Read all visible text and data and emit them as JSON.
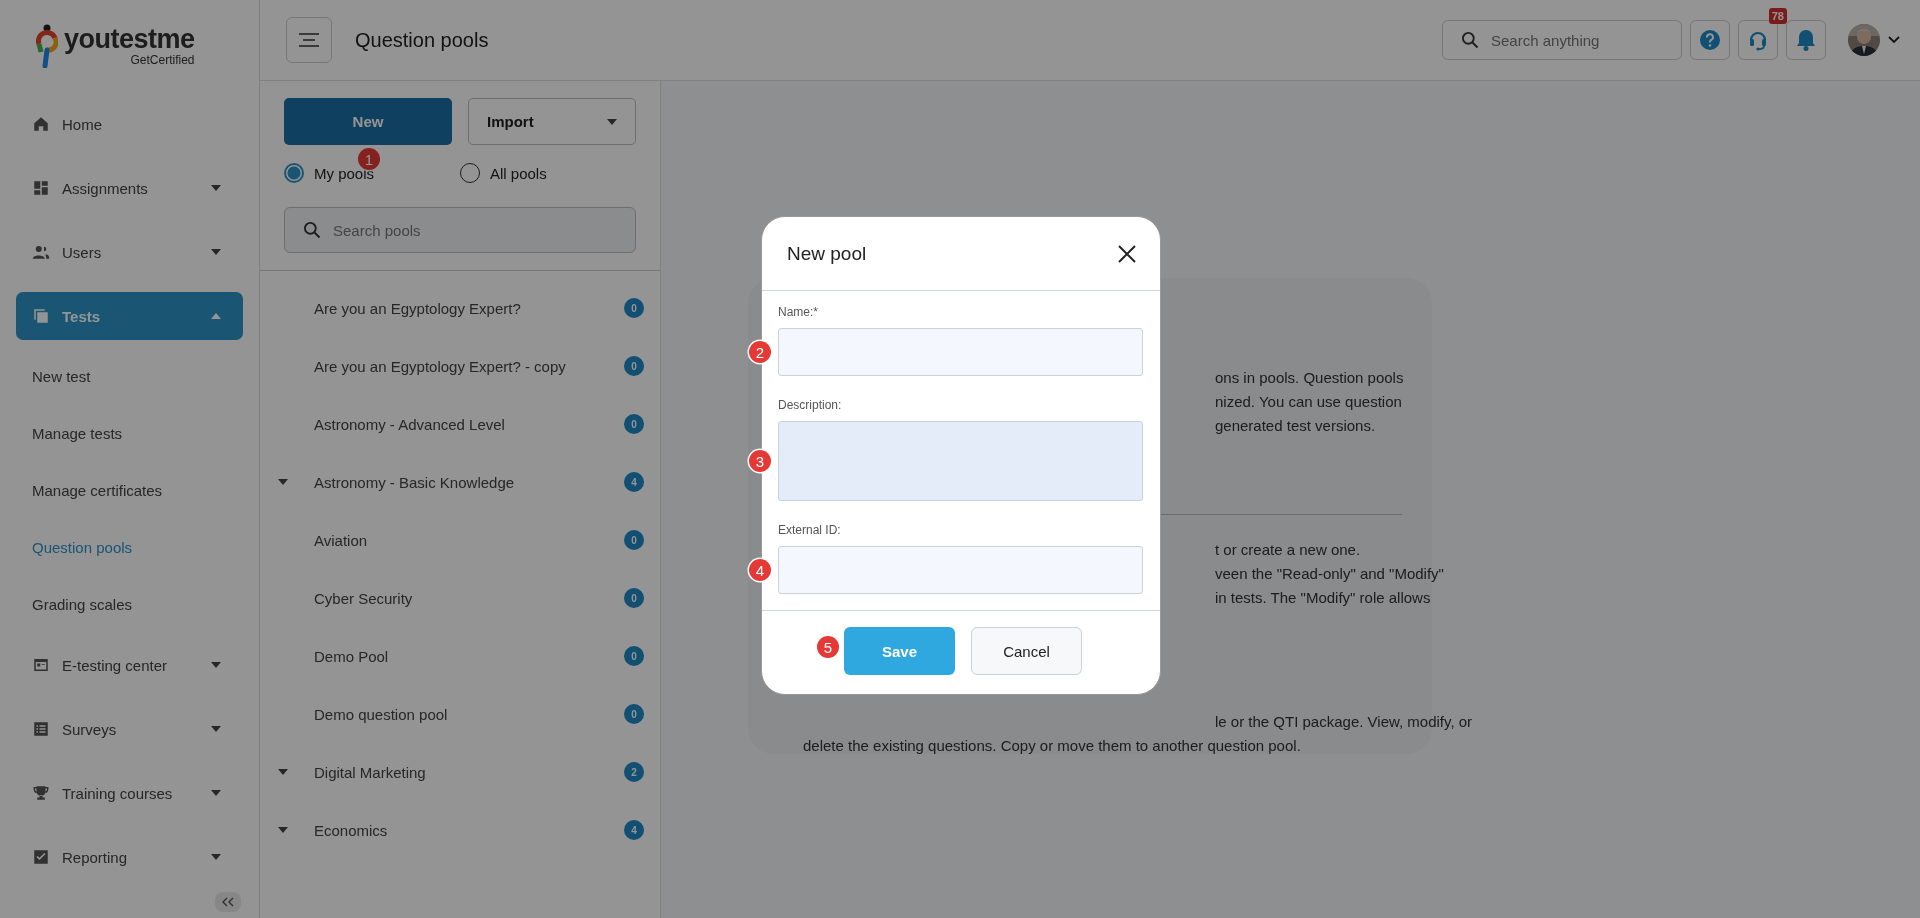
{
  "logo": {
    "brand": "youtestme",
    "tagline": "GetCertified"
  },
  "sidebar": {
    "items": [
      {
        "label": "Home",
        "selected": false,
        "kind": "main"
      },
      {
        "label": "Assignments",
        "expanded": false,
        "selected": false,
        "kind": "main"
      },
      {
        "label": "Users",
        "expanded": false,
        "selected": false,
        "kind": "main"
      },
      {
        "label": "Tests",
        "expanded": true,
        "selected": true,
        "kind": "main"
      },
      {
        "label": "New test",
        "selected": false,
        "kind": "sub"
      },
      {
        "label": "Manage tests",
        "selected": false,
        "kind": "sub"
      },
      {
        "label": "Manage certificates",
        "selected": false,
        "kind": "sub"
      },
      {
        "label": "Question pools",
        "selected": true,
        "kind": "sub"
      },
      {
        "label": "Grading scales",
        "selected": false,
        "kind": "sub"
      },
      {
        "label": "E-testing center",
        "expanded": false,
        "selected": false,
        "kind": "main"
      },
      {
        "label": "Surveys",
        "expanded": false,
        "selected": false,
        "kind": "main"
      },
      {
        "label": "Training courses",
        "expanded": false,
        "selected": false,
        "kind": "main"
      },
      {
        "label": "Reporting",
        "expanded": false,
        "selected": false,
        "kind": "main"
      }
    ]
  },
  "header": {
    "title": "Question pools",
    "search": {
      "placeholder": "Search anything"
    },
    "notifications": "78"
  },
  "pools_panel": {
    "new_button": "New",
    "import_button": "Import",
    "filters": [
      {
        "label": "My pools",
        "selected": true
      },
      {
        "label": "All pools",
        "selected": false
      }
    ],
    "search": {
      "placeholder": "Search pools"
    },
    "pools": [
      {
        "name": "Are you an Egyptology Expert?",
        "count": "0",
        "expandable": false
      },
      {
        "name": "Are you an Egyptology Expert? - copy",
        "count": "0",
        "expandable": false
      },
      {
        "name": "Astronomy - Advanced Level",
        "count": "0",
        "expandable": false
      },
      {
        "name": "Astronomy - Basic Knowledge",
        "count": "4",
        "expandable": true
      },
      {
        "name": "Aviation",
        "count": "0",
        "expandable": false
      },
      {
        "name": "Cyber Security",
        "count": "0",
        "expandable": false
      },
      {
        "name": "Demo Pool",
        "count": "0",
        "expandable": false
      },
      {
        "name": "Demo question pool",
        "count": "0",
        "expandable": false
      },
      {
        "name": "Digital Marketing",
        "count": "2",
        "expandable": true
      },
      {
        "name": "Economics",
        "count": "4",
        "expandable": true
      }
    ]
  },
  "info_card": {
    "paragraphs": [
      {
        "lines": [
          {
            "text": "ons in pools. Question pools",
            "kind": "partial"
          },
          {
            "text": "nized. You can use question",
            "kind": "partial"
          },
          {
            "text": "generated test versions.",
            "kind": "partial"
          }
        ]
      },
      {
        "lines": [
          {
            "text": "t or create a new one.",
            "kind": "partial"
          },
          {
            "text": "veen the \"Read-only\" and \"Modify\"",
            "kind": "partial"
          },
          {
            "text": "in tests. The \"Modify\" role allows",
            "kind": "partial"
          }
        ]
      },
      {
        "lines": [
          {
            "text": "le or the QTI package. View, modify, or",
            "kind": "partial"
          },
          {
            "text": "delete the existing questions. Copy or move them to another question pool.",
            "kind": "full"
          }
        ]
      }
    ]
  },
  "dialog": {
    "title": "New pool",
    "fields": [
      {
        "label": "Name:*",
        "kind": "input",
        "marker": "2"
      },
      {
        "label": "Description:",
        "kind": "textarea",
        "marker": "3"
      },
      {
        "label": "External ID:",
        "kind": "input",
        "marker": "4"
      }
    ],
    "save_button": "Save",
    "cancel_button": "Cancel",
    "save_marker": "5"
  },
  "new_marker": "1"
}
